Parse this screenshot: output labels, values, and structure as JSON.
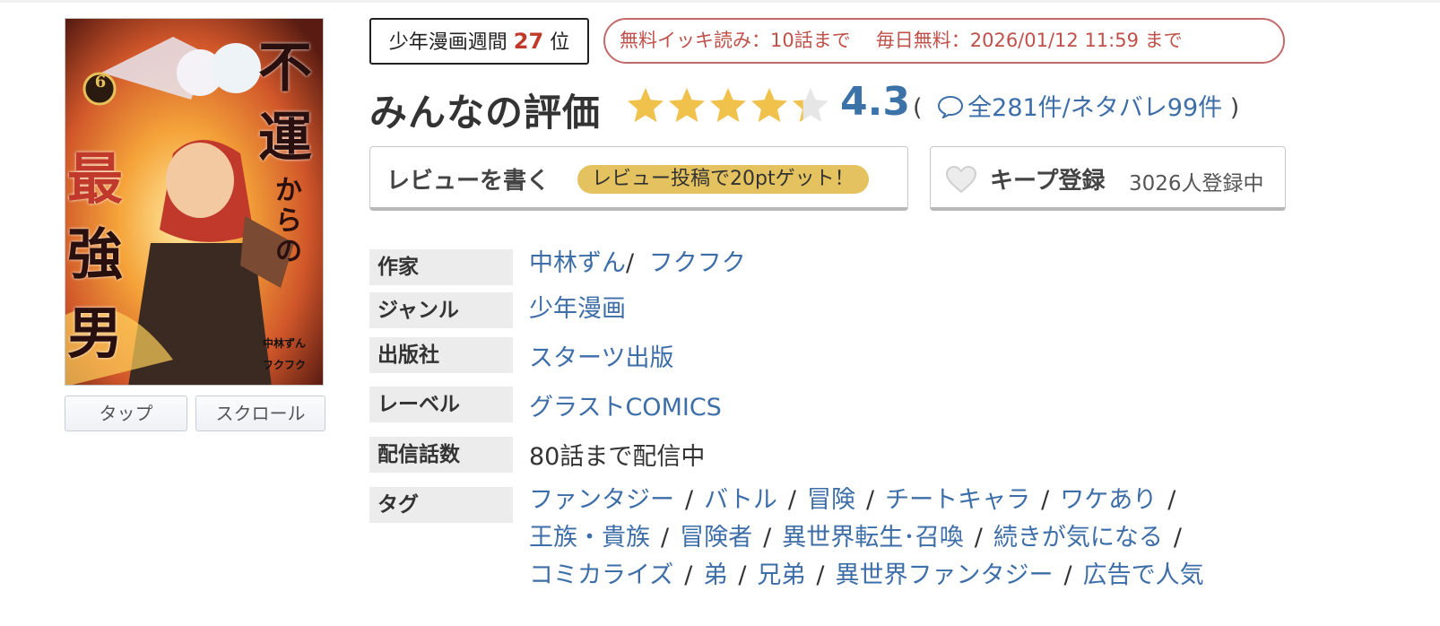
{
  "cover": {
    "title_chars": [
      "不",
      "運",
      "か",
      "ら",
      "の",
      "最",
      "強",
      "男"
    ],
    "volume": "6",
    "credit_names": [
      "中林ずん",
      "フクフク"
    ]
  },
  "view_buttons": {
    "tap": "タップ",
    "scroll": "スクロール"
  },
  "rank": {
    "prefix": "少年漫画週間",
    "number": "27",
    "suffix": "位"
  },
  "free": {
    "ikki": "無料イッキ読み：10話まで",
    "daily": "毎日無料：2026/01/12 11:59 まで"
  },
  "rating": {
    "title": "みんなの評価",
    "score": "4.3",
    "stars_value": 4.3,
    "stars_max": 5,
    "star_color": "#f0c24b",
    "paren_open": "(",
    "paren_close": ")",
    "reviews_link": "全281件/ネタバレ99件",
    "icon": "speech-bubble-icon"
  },
  "review_button": {
    "label": "レビューを書く",
    "promo": "レビュー投稿で20ptゲット！"
  },
  "keep_button": {
    "label": "キープ登録",
    "count": "3026人登録中",
    "icon": "heart-icon"
  },
  "info": {
    "author": {
      "label": "作家",
      "names": [
        "中林ずん",
        "フクフク"
      ],
      "separator": "/"
    },
    "genre": {
      "label": "ジャンル",
      "value": "少年漫画"
    },
    "publisher": {
      "label": "出版社",
      "value": "スターツ出版"
    },
    "imprint": {
      "label": "レーベル",
      "value": "グラストCOMICS"
    },
    "episodes": {
      "label": "配信話数",
      "value": "80話まで配信中"
    },
    "tags": {
      "label": "タグ",
      "separator": "/",
      "lines": [
        [
          "ファンタジー",
          "バトル",
          "冒険",
          "チートキャラ",
          "ワケあり"
        ],
        [
          "王族・貴族",
          "冒険者",
          "異世界転生･召喚",
          "続きが気になる"
        ],
        [
          "コミカライズ",
          "弟",
          "兄弟",
          "異世界ファンタジー",
          "広告で人気"
        ]
      ]
    }
  },
  "colors": {
    "link": "#3d6ea8",
    "rank_accent": "#c0392b",
    "free_border": "#c26a6a",
    "promo_bg": "#e3c25f",
    "label_bg": "#ececec"
  }
}
